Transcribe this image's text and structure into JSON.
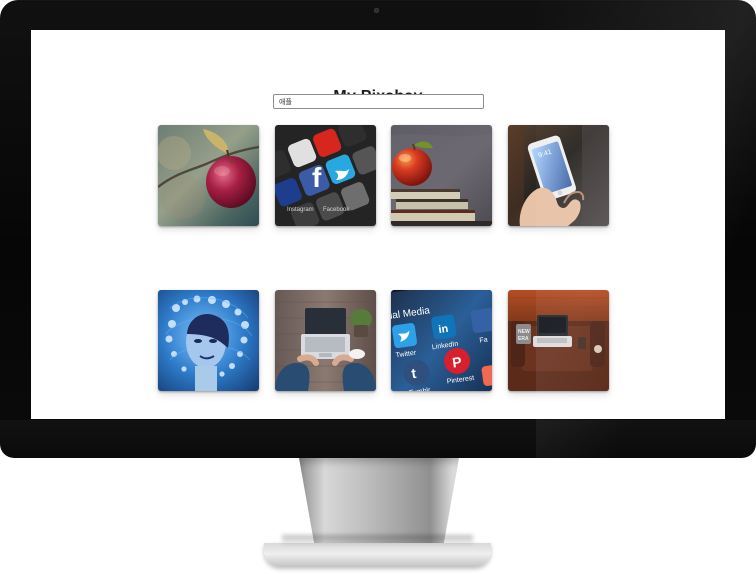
{
  "app": {
    "title": "My Pixabay"
  },
  "search": {
    "value": "애플",
    "placeholder": ""
  },
  "gallery": {
    "items": [
      {
        "label": "Apple on branch",
        "icon": "apple-image"
      },
      {
        "label": "Social media app icons",
        "icon": "social-icons-image"
      },
      {
        "label": "Apple on books",
        "icon": "apple-books-image"
      },
      {
        "label": "Hand holding iPhone",
        "icon": "phone-image"
      },
      {
        "label": "Woman with social icons",
        "icon": "social-woman-image"
      },
      {
        "label": "Laptop on desk",
        "icon": "laptop-desk-image"
      },
      {
        "label": "Social media icons on screen",
        "icon": "social-screen-image"
      },
      {
        "label": "Laptop on couch",
        "icon": "laptop-couch-image"
      }
    ]
  },
  "colors": {
    "screen_background": "#ffffff",
    "monitor_frame": "#080808",
    "title": "#1c1c1c"
  }
}
